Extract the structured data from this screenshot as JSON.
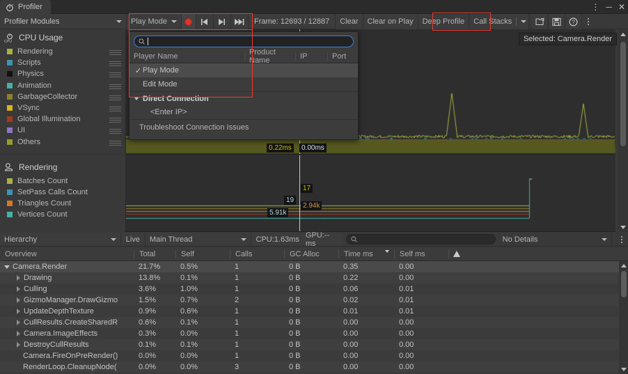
{
  "window": {
    "tab_title": "Profiler",
    "tab_icon": "stopwatch-icon",
    "controls": [
      "minimize",
      "maximize",
      "close"
    ]
  },
  "toolbar": {
    "modules_label": "Profiler Modules",
    "play_mode_label": "Play Mode",
    "record_icon": "record-icon",
    "prev_frame_icon": "step-back-icon",
    "next_frame_icon": "step-forward-icon",
    "last_frame_icon": "jump-to-last-frame-icon",
    "frame_label": "Frame: 12693 / 12887",
    "clear_label": "Clear",
    "clear_on_play_label": "Clear on Play",
    "deep_profile_label": "Deep Profile",
    "call_stacks_label": "Call Stacks",
    "load_icon": "open-file-icon",
    "save_icon": "save-icon",
    "help_icon": "help-icon",
    "menu_icon": "kebab-menu-icon"
  },
  "connection_popup": {
    "search_placeholder": "",
    "search_value": "",
    "columns": [
      "Player Name",
      "Product Name",
      "IP",
      "Port"
    ],
    "items": [
      {
        "label": "Play Mode",
        "checked": true,
        "selected": true
      },
      {
        "label": "Edit Mode",
        "checked": false,
        "selected": false
      }
    ],
    "group_label": "Direct Connection",
    "group_item": "<Enter IP>",
    "footer": "Troubleshoot Connection Issues"
  },
  "selection_tooltip": "Selected: Camera.Render",
  "modules": [
    {
      "title": "CPU Usage",
      "icon": "cpu-icon",
      "legend": [
        {
          "label": "Rendering",
          "color": "#a9b23c"
        },
        {
          "label": "Scripts",
          "color": "#3a94b0"
        },
        {
          "label": "Physics",
          "color": "#111111"
        },
        {
          "label": "Animation",
          "color": "#43b3a6"
        },
        {
          "label": "GarbageCollector",
          "color": "#8a8228"
        },
        {
          "label": "VSync",
          "color": "#d7b41c"
        },
        {
          "label": "Global Illumination",
          "color": "#a33a18"
        },
        {
          "label": "UI",
          "color": "#8c76c4"
        },
        {
          "label": "Others",
          "color": "#9a9a2b"
        }
      ]
    },
    {
      "title": "Rendering",
      "icon": "rendering-icon",
      "legend": [
        {
          "label": "Batches Count",
          "color": "#a9b23c"
        },
        {
          "label": "SetPass Calls Count",
          "color": "#3a94b0"
        },
        {
          "label": "Triangles Count",
          "color": "#d4762a"
        },
        {
          "label": "Vertices Count",
          "color": "#43b3a6"
        }
      ]
    }
  ],
  "chart_data": [
    {
      "type": "area",
      "title": "CPU Usage",
      "ylabel": "ms",
      "annotations": [
        {
          "text": "0.22ms",
          "color": "#c9c000"
        },
        {
          "text": "0.00ms",
          "color": "#9fd6e8"
        }
      ],
      "series": [
        {
          "name": "Rendering",
          "color": "#a9b23c",
          "baseline": 0.18,
          "spike_at": 0.72,
          "spike_value": 0.95
        },
        {
          "name": "Others",
          "color": "#9a9a2b",
          "baseline": 0.12
        }
      ],
      "ylim": [
        0,
        1.0
      ],
      "grid": false
    },
    {
      "type": "line",
      "title": "Rendering",
      "annotations": [
        {
          "text": "17",
          "color": "#c9c000"
        },
        {
          "text": "19",
          "color": "#9fd6e8"
        },
        {
          "text": "2.94k",
          "color": "#d4934a"
        },
        {
          "text": "5.91k",
          "color": "#9fd6e8"
        }
      ],
      "series": [
        {
          "name": "Batches Count",
          "color": "#a9b23c",
          "value": 17
        },
        {
          "name": "SetPass Calls Count",
          "color": "#3a94b0",
          "value": 19
        },
        {
          "name": "Triangles Count",
          "color": "#d4762a",
          "value": 2940
        },
        {
          "name": "Vertices Count",
          "color": "#43b3a6",
          "value": 5910
        }
      ],
      "grid": false
    }
  ],
  "hierarchy_bar": {
    "view_label": "Hierarchy",
    "live_label": "Live",
    "thread_label": "Main Thread",
    "cpu_label": "CPU:1.63ms",
    "gpu_label": "GPU:--ms",
    "search_value": "",
    "details_label": "No Details",
    "menu_icon": "kebab-menu-icon"
  },
  "table": {
    "columns": [
      "Overview",
      "Total",
      "Self",
      "Calls",
      "GC Alloc",
      "Time ms",
      "Self ms",
      ""
    ],
    "sort_column": "Time ms",
    "sort_dir": "desc",
    "warning_column_icon": "warning-triangle-icon",
    "rows": [
      {
        "name": "Camera.Render",
        "depth": 0,
        "expander": "down",
        "total": "21.7%",
        "self": "0.5%",
        "calls": "1",
        "gc": "0 B",
        "time": "0.35",
        "selfms": "0.00",
        "selected": true
      },
      {
        "name": "Drawing",
        "depth": 1,
        "expander": "right",
        "total": "13.8%",
        "self": "0.1%",
        "calls": "1",
        "gc": "0 B",
        "time": "0.22",
        "selfms": "0.00",
        "selected": false
      },
      {
        "name": "Culling",
        "depth": 1,
        "expander": "right",
        "total": "3.6%",
        "self": "1.0%",
        "calls": "1",
        "gc": "0 B",
        "time": "0.06",
        "selfms": "0.01",
        "selected": false
      },
      {
        "name": "GizmoManager.DrawGizmo",
        "depth": 1,
        "expander": "right",
        "total": "1.5%",
        "self": "0.7%",
        "calls": "2",
        "gc": "0 B",
        "time": "0.02",
        "selfms": "0.01",
        "selected": false
      },
      {
        "name": "UpdateDepthTexture",
        "depth": 1,
        "expander": "right",
        "total": "0.9%",
        "self": "0.6%",
        "calls": "1",
        "gc": "0 B",
        "time": "0.01",
        "selfms": "0.01",
        "selected": false
      },
      {
        "name": "CullResults.CreateSharedR",
        "depth": 1,
        "expander": "right",
        "total": "0.6%",
        "self": "0.1%",
        "calls": "1",
        "gc": "0 B",
        "time": "0.00",
        "selfms": "0.00",
        "selected": false
      },
      {
        "name": "Camera.ImageEffects",
        "depth": 1,
        "expander": "right",
        "total": "0.3%",
        "self": "0.0%",
        "calls": "1",
        "gc": "0 B",
        "time": "0.00",
        "selfms": "0.00",
        "selected": false
      },
      {
        "name": "DestroyCullResults",
        "depth": 1,
        "expander": "right",
        "total": "0.1%",
        "self": "0.1%",
        "calls": "1",
        "gc": "0 B",
        "time": "0.00",
        "selfms": "0.00",
        "selected": false
      },
      {
        "name": "Camera.FireOnPreRender()",
        "depth": 1,
        "expander": "none",
        "total": "0.0%",
        "self": "0.0%",
        "calls": "1",
        "gc": "0 B",
        "time": "0.00",
        "selfms": "0.00",
        "selected": false
      },
      {
        "name": "RenderLoop.CleanupNode(",
        "depth": 1,
        "expander": "none",
        "total": "0.0%",
        "self": "0.0%",
        "calls": "3",
        "gc": "0 B",
        "time": "0.00",
        "selfms": "0.00",
        "selected": false
      }
    ]
  },
  "colors": {
    "red_highlight": "#f03a2e",
    "panel_bg": "#393939",
    "chart_bg": "#2e2e2e"
  }
}
